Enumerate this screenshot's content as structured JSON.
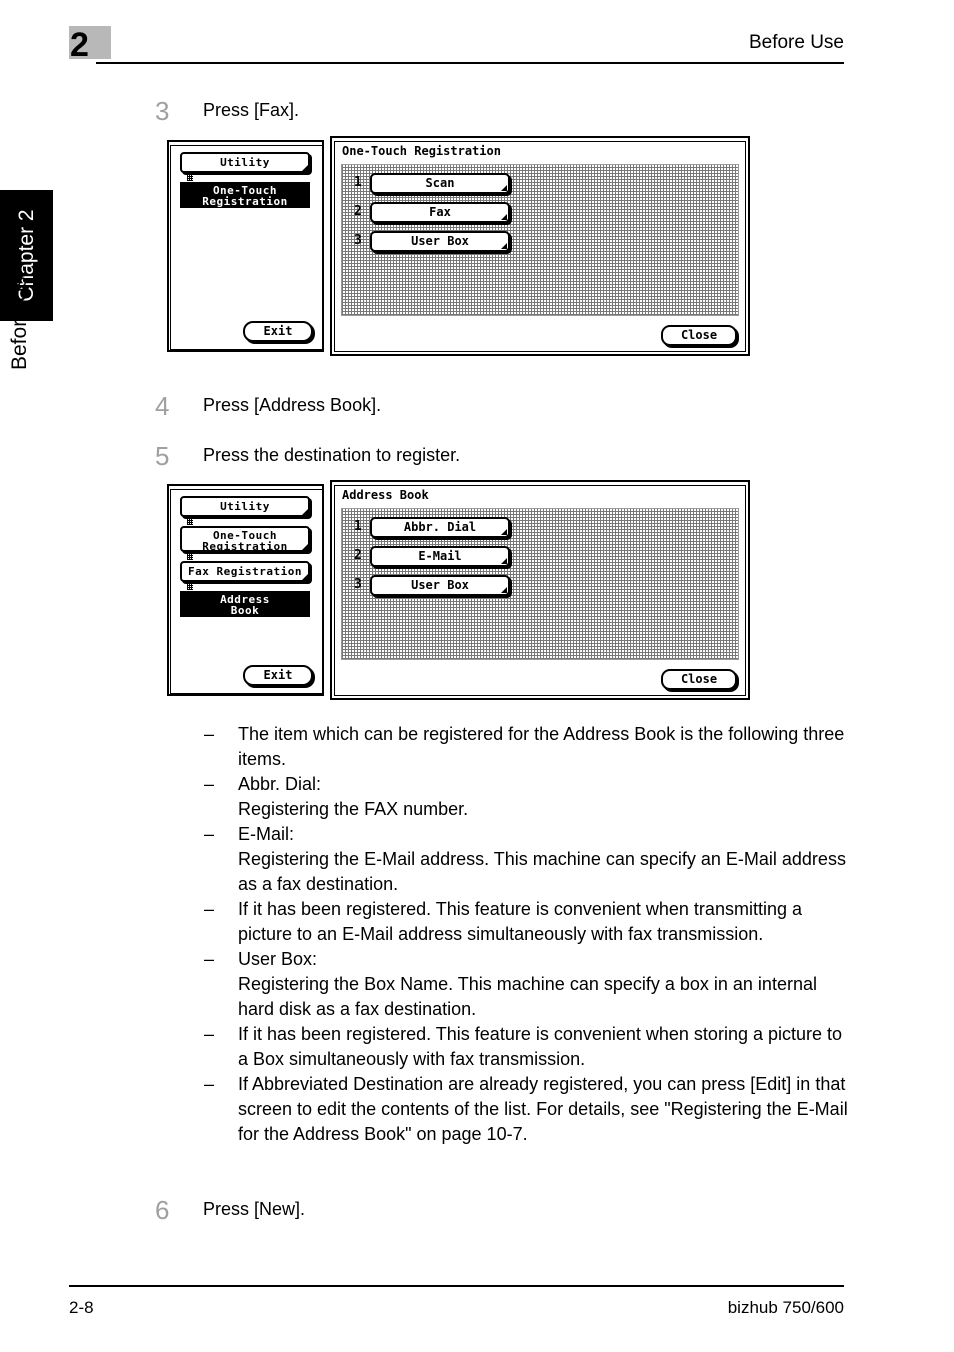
{
  "header": {
    "chapter_number": "2",
    "title": "Before Use"
  },
  "sidebar": {
    "chapter_tab": "Chapter 2",
    "section_label": "Before Use"
  },
  "footer": {
    "page_number": "2-8",
    "product": "bizhub 750/600"
  },
  "steps": [
    {
      "number": "3",
      "text": "Press [Fax]."
    },
    {
      "number": "4",
      "text": "Press [Address Book]."
    },
    {
      "number": "5",
      "text": "Press the destination to register."
    },
    {
      "number": "6",
      "text": "Press [New]."
    }
  ],
  "figure1": {
    "left_panel": {
      "items": [
        {
          "label": "Utility",
          "selected": false
        },
        {
          "label_line1": "One-Touch",
          "label_line2": "Registration",
          "selected": true
        }
      ],
      "exit_label": "Exit"
    },
    "right_panel": {
      "title": "One-Touch Registration",
      "rows": [
        {
          "num": "1",
          "label": "Scan"
        },
        {
          "num": "2",
          "label": "Fax"
        },
        {
          "num": "3",
          "label": "User Box"
        }
      ],
      "close_label": "Close"
    }
  },
  "figure2": {
    "left_panel": {
      "items": [
        {
          "label": "Utility",
          "selected": false
        },
        {
          "label_line1": "One-Touch",
          "label_line2": "Registration",
          "selected": false
        },
        {
          "label": "Fax Registration",
          "selected": false
        },
        {
          "label_line1": "Address",
          "label_line2": "Book",
          "selected": true
        }
      ],
      "exit_label": "Exit"
    },
    "right_panel": {
      "title": "Address Book",
      "rows": [
        {
          "num": "1",
          "label": "Abbr. Dial"
        },
        {
          "num": "2",
          "label": "E-Mail"
        },
        {
          "num": "3",
          "label": "User Box"
        }
      ],
      "close_label": "Close"
    }
  },
  "notes": {
    "dash": "–",
    "items": [
      {
        "body": "The item which can be registered for the Address Book is the following three items."
      },
      {
        "body": "Abbr. Dial:",
        "sub": "Registering the FAX number."
      },
      {
        "body": "E-Mail:",
        "sub": "Registering the E-Mail address. This machine can specify an E-Mail address as a fax destination."
      },
      {
        "body": "If it has been registered. This feature is convenient when transmitting a picture to an E-Mail address simultaneously with fax transmission."
      },
      {
        "body": "User Box:",
        "sub": "Registering the Box Name. This machine can specify a box in an internal hard disk as a fax destination."
      },
      {
        "body": "If it has been registered. This feature is convenient when storing a picture to a Box simultaneously with fax transmission."
      },
      {
        "body": "If Abbreviated Destination are already registered, you can press [Edit] in that screen to edit the contents of the list. For details, see \"Registering the E-Mail for the Address Book\" on page 10-7."
      }
    ]
  }
}
